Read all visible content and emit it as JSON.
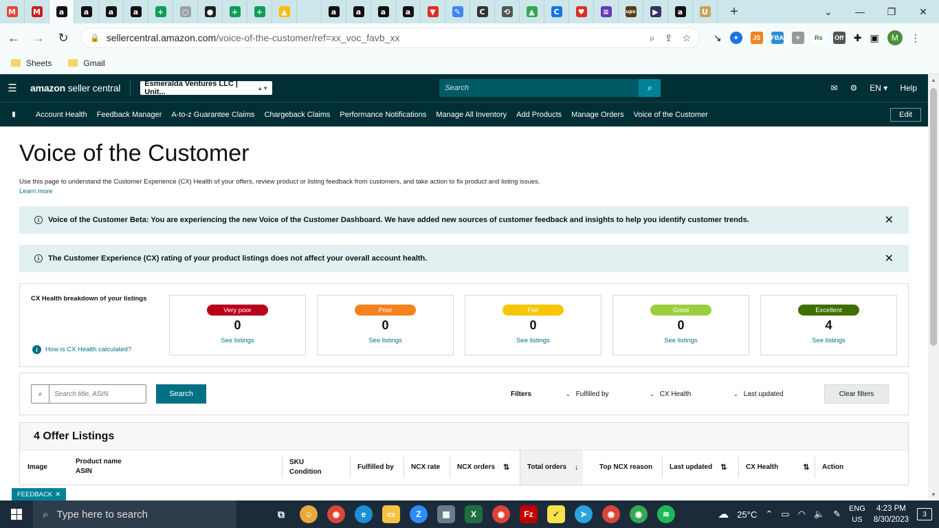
{
  "browser": {
    "tabs": [
      {
        "name": "gmail-tab-1",
        "glyph": "M",
        "color": "#ea4335"
      },
      {
        "name": "gmail-tab-2",
        "glyph": "M",
        "color": "#c5221f"
      },
      {
        "name": "amazon-tab-active",
        "glyph": "a",
        "color": "#111111",
        "active": true
      },
      {
        "name": "amazon-tab-2",
        "glyph": "a",
        "color": "#111111"
      },
      {
        "name": "amazon-tab-3",
        "glyph": "a",
        "color": "#111111"
      },
      {
        "name": "amazon-tab-4",
        "glyph": "a",
        "color": "#111111"
      },
      {
        "name": "sheets-tab-1",
        "glyph": "+",
        "color": "#0f9d58"
      },
      {
        "name": "blank-tab",
        "glyph": "○",
        "color": "#9aa0a6"
      },
      {
        "name": "profile-tab",
        "glyph": "●",
        "color": "#222222"
      },
      {
        "name": "sheets-tab-2",
        "glyph": "+",
        "color": "#0f9d58"
      },
      {
        "name": "sheets-tab-3",
        "glyph": "+",
        "color": "#0f9d58"
      },
      {
        "name": "drive-tab",
        "glyph": "▲",
        "color": "#fbbc04"
      },
      {
        "name": "blank-tab-2",
        "glyph": "",
        "color": "#cde6ea"
      },
      {
        "name": "amazon-tab-5",
        "glyph": "a",
        "color": "#111111"
      },
      {
        "name": "amazon-tab-6",
        "glyph": "a",
        "color": "#111111"
      },
      {
        "name": "amazon-tab-7",
        "glyph": "a",
        "color": "#111111"
      },
      {
        "name": "amazon-tab-8",
        "glyph": "a",
        "color": "#111111"
      },
      {
        "name": "triangle-tab",
        "glyph": "▼",
        "color": "#d93025"
      },
      {
        "name": "paint-tab",
        "glyph": "✎",
        "color": "#4285f4"
      },
      {
        "name": "c-tab",
        "glyph": "C",
        "color": "#333333"
      },
      {
        "name": "history-tab",
        "glyph": "⟲",
        "color": "#555555"
      },
      {
        "name": "drive-tab-2",
        "glyph": "▲",
        "color": "#34a853"
      },
      {
        "name": "c-blue-tab",
        "glyph": "C",
        "color": "#1a73e8"
      },
      {
        "name": "heart-tab",
        "glyph": "♥",
        "color": "#d93025"
      },
      {
        "name": "list-tab",
        "glyph": "≡",
        "color": "#673ab7"
      },
      {
        "name": "ups-tab",
        "glyph": "ups",
        "color": "#5a3a1a"
      },
      {
        "name": "usps-tab",
        "glyph": "▶",
        "color": "#333366"
      },
      {
        "name": "amazon-tab-9",
        "glyph": "a",
        "color": "#111111"
      },
      {
        "name": "uline-tab",
        "glyph": "U",
        "color": "#c8a45a"
      }
    ],
    "url_host": "sellercentral.amazon.com",
    "url_path": "/voice-of-the-customer/ref=xx_voc_favb_xx",
    "bookmarks": [
      "Sheets",
      "Gmail"
    ],
    "profile_initial": "M"
  },
  "header": {
    "logo_bold": "amazon",
    "logo_rest": " seller central",
    "account": "Esmeralda Ventures LLC | Unit...",
    "search_placeholder": "Search",
    "lang": "EN",
    "help": "Help"
  },
  "nav": {
    "links": [
      "Account Health",
      "Feedback Manager",
      "A-to-z Guarantee Claims",
      "Chargeback Claims",
      "Performance Notifications",
      "Manage All Inventory",
      "Add Products",
      "Manage Orders",
      "Voice of the Customer"
    ],
    "edit": "Edit"
  },
  "page": {
    "title": "Voice of the Customer",
    "description": "Use this page to understand the Customer Experience (CX) Health of your offers, review product or listing feedback from customers, and take action to fix product and listing issues.",
    "learn_more": "Learn more",
    "alert1": "Voice of the Customer Beta: You are experiencing the new Voice of the Customer Dashboard. We have added new sources of customer feedback and insights to help you identify customer trends.",
    "alert2": "The Customer Experience (CX) rating of your product listings does not affect your overall account health."
  },
  "cx": {
    "label": "CX Health breakdown of your listings",
    "how": "How is CX Health calculated?",
    "cards": [
      {
        "label": "Very poor",
        "count": "0",
        "link": "See listings",
        "color": "#b7001a"
      },
      {
        "label": "Poor",
        "count": "0",
        "link": "See listings",
        "color": "#f5811f"
      },
      {
        "label": "Fair",
        "count": "0",
        "link": "See listings",
        "color": "#f7c600"
      },
      {
        "label": "Good",
        "count": "0",
        "link": "See listings",
        "color": "#9bce3f"
      },
      {
        "label": "Excellent",
        "count": "4",
        "link": "See listings",
        "color": "#3f6f00"
      }
    ]
  },
  "filters": {
    "search_placeholder": "Search title, ASIN",
    "search_button": "Search",
    "label": "Filters",
    "fulfilled_by": "Fulfilled by",
    "cx_health": "CX Health",
    "last_updated": "Last updated",
    "clear": "Clear filters"
  },
  "listings": {
    "title": "4 Offer Listings",
    "columns": {
      "image": "Image",
      "product_name": "Product name",
      "asin": "ASIN",
      "sku": "SKU",
      "condition": "Condition",
      "fulfilled_by": "Fulfilled by",
      "ncx_rate": "NCX rate",
      "ncx_orders": "NCX orders",
      "total_orders": "Total orders",
      "top_ncx_reason": "Top NCX reason",
      "last_updated": "Last updated",
      "cx_health": "CX Health",
      "action": "Action"
    }
  },
  "feedback": "FEEDBACK",
  "taskbar": {
    "search": "Type here to search",
    "weather": "25°C",
    "lang1": "ENG",
    "lang2": "US",
    "time": "4:23 PM",
    "date": "8/30/2023",
    "notifications": "3"
  }
}
